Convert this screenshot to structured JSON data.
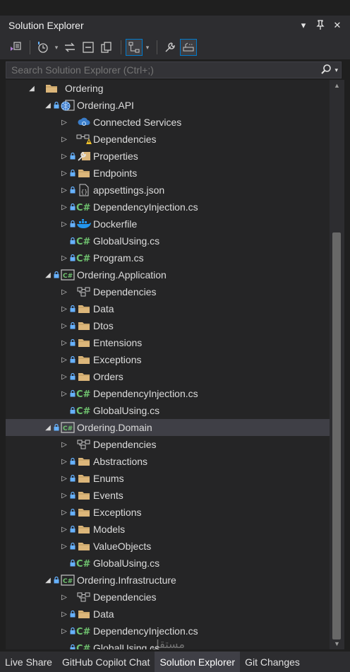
{
  "window": {
    "title": "Solution Explorer"
  },
  "search": {
    "placeholder": "Search Solution Explorer (Ctrl+;)"
  },
  "tree": [
    {
      "label": "Ordering",
      "icon": "folder",
      "depth": 0,
      "expander": "expanded",
      "lock": false
    },
    {
      "label": "Ordering.API",
      "icon": "web-project",
      "depth": 1,
      "expander": "expanded",
      "lock": true
    },
    {
      "label": "Connected Services",
      "icon": "connected-services",
      "depth": 2,
      "expander": "collapsed",
      "lock": false
    },
    {
      "label": "Dependencies",
      "icon": "dependencies-warning",
      "depth": 2,
      "expander": "collapsed",
      "lock": false
    },
    {
      "label": "Properties",
      "icon": "properties",
      "depth": 2,
      "expander": "collapsed",
      "lock": true
    },
    {
      "label": "Endpoints",
      "icon": "folder",
      "depth": 2,
      "expander": "collapsed",
      "lock": true
    },
    {
      "label": "appsettings.json",
      "icon": "json",
      "depth": 2,
      "expander": "collapsed",
      "lock": true
    },
    {
      "label": "DependencyInjection.cs",
      "icon": "csharp",
      "depth": 2,
      "expander": "collapsed",
      "lock": true
    },
    {
      "label": "Dockerfile",
      "icon": "docker",
      "depth": 2,
      "expander": "collapsed",
      "lock": true
    },
    {
      "label": "GlobalUsing.cs",
      "icon": "csharp",
      "depth": 2,
      "expander": "none",
      "lock": true
    },
    {
      "label": "Program.cs",
      "icon": "csharp",
      "depth": 2,
      "expander": "collapsed",
      "lock": true
    },
    {
      "label": "Ordering.Application",
      "icon": "csharp-project",
      "depth": 1,
      "expander": "expanded",
      "lock": true
    },
    {
      "label": "Dependencies",
      "icon": "dependencies",
      "depth": 2,
      "expander": "collapsed",
      "lock": false
    },
    {
      "label": "Data",
      "icon": "folder",
      "depth": 2,
      "expander": "collapsed",
      "lock": true
    },
    {
      "label": "Dtos",
      "icon": "folder",
      "depth": 2,
      "expander": "collapsed",
      "lock": true
    },
    {
      "label": "Entensions",
      "icon": "folder",
      "depth": 2,
      "expander": "collapsed",
      "lock": true
    },
    {
      "label": "Exceptions",
      "icon": "folder",
      "depth": 2,
      "expander": "collapsed",
      "lock": true
    },
    {
      "label": "Orders",
      "icon": "folder",
      "depth": 2,
      "expander": "collapsed",
      "lock": true
    },
    {
      "label": "DependencyInjection.cs",
      "icon": "csharp",
      "depth": 2,
      "expander": "collapsed",
      "lock": true
    },
    {
      "label": "GlobalUsing.cs",
      "icon": "csharp",
      "depth": 2,
      "expander": "none",
      "lock": true
    },
    {
      "label": "Ordering.Domain",
      "icon": "csharp-project",
      "depth": 1,
      "expander": "expanded",
      "lock": true,
      "selected": true
    },
    {
      "label": "Dependencies",
      "icon": "dependencies",
      "depth": 2,
      "expander": "collapsed",
      "lock": false
    },
    {
      "label": "Abstractions",
      "icon": "folder",
      "depth": 2,
      "expander": "collapsed",
      "lock": true
    },
    {
      "label": "Enums",
      "icon": "folder",
      "depth": 2,
      "expander": "collapsed",
      "lock": true
    },
    {
      "label": "Events",
      "icon": "folder",
      "depth": 2,
      "expander": "collapsed",
      "lock": true
    },
    {
      "label": "Exceptions",
      "icon": "folder",
      "depth": 2,
      "expander": "collapsed",
      "lock": true
    },
    {
      "label": "Models",
      "icon": "folder",
      "depth": 2,
      "expander": "collapsed",
      "lock": true
    },
    {
      "label": "ValueObjects",
      "icon": "folder",
      "depth": 2,
      "expander": "collapsed",
      "lock": true
    },
    {
      "label": "GlobalUsing.cs",
      "icon": "csharp",
      "depth": 2,
      "expander": "none",
      "lock": true
    },
    {
      "label": "Ordering.Infrastructure",
      "icon": "csharp-project",
      "depth": 1,
      "expander": "expanded",
      "lock": true
    },
    {
      "label": "Dependencies",
      "icon": "dependencies",
      "depth": 2,
      "expander": "collapsed",
      "lock": false
    },
    {
      "label": "Data",
      "icon": "folder",
      "depth": 2,
      "expander": "collapsed",
      "lock": true
    },
    {
      "label": "DependencyInjection.cs",
      "icon": "csharp",
      "depth": 2,
      "expander": "collapsed",
      "lock": true
    },
    {
      "label": "GlobalUsing.cs",
      "icon": "csharp",
      "depth": 2,
      "expander": "none",
      "lock": true
    }
  ],
  "bottom_tabs": [
    {
      "label": "Live Share",
      "active": false
    },
    {
      "label": "GitHub Copilot Chat",
      "active": false
    },
    {
      "label": "Solution Explorer",
      "active": true
    },
    {
      "label": "Git Changes",
      "active": false
    }
  ],
  "watermark": "مستقل",
  "colors": {
    "folder": "#dcb67a",
    "csharp": "#6fc26f",
    "accent": "#007acc",
    "lock": "#66b1ff",
    "selected": "#3f3f46"
  }
}
